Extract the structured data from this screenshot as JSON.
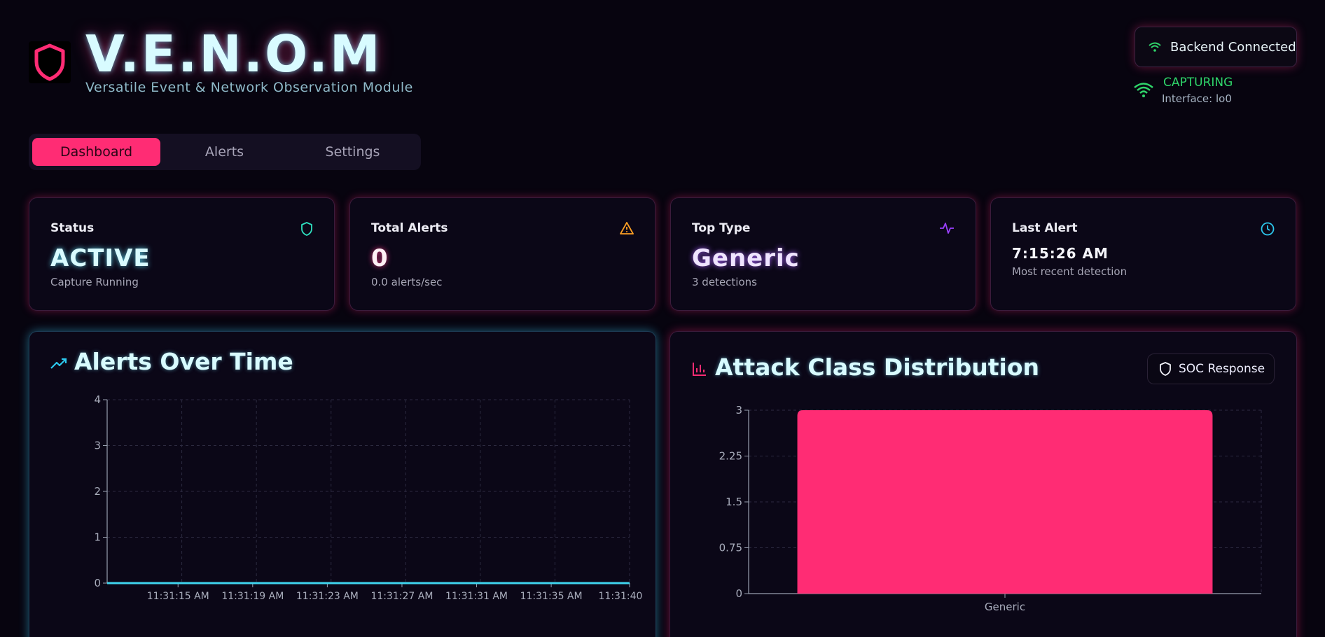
{
  "app": {
    "title": "V.E.N.O.M",
    "subtitle": "Versatile Event & Network Observation Module"
  },
  "header": {
    "backend_status": "Backend Connected",
    "capture_label": "CAPTURING",
    "interface_label": "Interface: lo0"
  },
  "tabs": [
    {
      "label": "Dashboard",
      "active": true
    },
    {
      "label": "Alerts",
      "active": false
    },
    {
      "label": "Settings",
      "active": false
    }
  ],
  "cards": [
    {
      "title": "Status",
      "value": "ACTIVE",
      "sub": "Capture Running",
      "icon": "shield-icon",
      "color": "#2fe0c0"
    },
    {
      "title": "Total Alerts",
      "value": "0",
      "sub": "0.0 alerts/sec",
      "icon": "warning-icon",
      "color": "#ffa024"
    },
    {
      "title": "Top Type",
      "value": "Generic",
      "sub": "3 detections",
      "icon": "activity-icon",
      "color": "#9b40ff"
    },
    {
      "title": "Last Alert",
      "value": "7:15:26 AM",
      "sub": "Most recent detection",
      "icon": "clock-icon",
      "color": "#2cc8ee"
    }
  ],
  "panels": {
    "alerts_over_time_title": "Alerts Over Time",
    "attack_class_title": "Attack Class Distribution",
    "soc_button": "SOC Response"
  },
  "colors": {
    "accent": "#ff2c74",
    "line": "#3fd4ee",
    "success": "#2fd56a"
  },
  "chart_data": [
    {
      "type": "line",
      "title": "Alerts Over Time",
      "x": [
        "11:31:15 AM",
        "11:31:19 AM",
        "11:31:23 AM",
        "11:31:27 AM",
        "11:31:31 AM",
        "11:31:35 AM",
        "11:31:40 AM"
      ],
      "values": [
        0,
        0,
        0,
        0,
        0,
        0,
        0
      ],
      "yticks": [
        0,
        1,
        2,
        3,
        4
      ],
      "ylim": [
        0,
        4
      ],
      "grid": true
    },
    {
      "type": "bar",
      "title": "Attack Class Distribution",
      "categories": [
        "Generic"
      ],
      "values": [
        3
      ],
      "yticks": [
        0,
        0.75,
        1.5,
        2.25,
        3
      ],
      "ylim": [
        0,
        3
      ],
      "grid": true
    }
  ]
}
